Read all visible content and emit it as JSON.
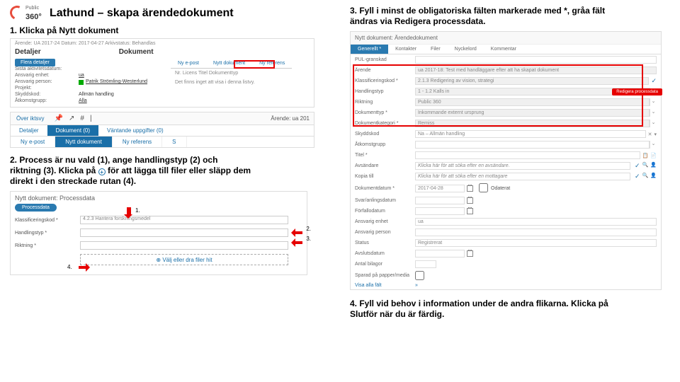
{
  "logo": {
    "brand": "Public",
    "num": "360°"
  },
  "title": "Lathund – skapa ärendedokument",
  "step1": "1. Klicka på Nytt dokument",
  "shot1": {
    "top": "Ärende: UA 2017-24   Datum: 2017-04-27   Arkivstatus: Behandlas",
    "detaljer": "Detaljer",
    "dokument": "Dokument",
    "flera": "Flera detaljer",
    "rows": [
      {
        "l": "Sista aktivitetsdatum:",
        "v": ""
      },
      {
        "l": "Ansvarig enhet:",
        "v": "ua",
        "link": true
      },
      {
        "l": "Ansvarig person:",
        "v": "Patrik Strömling-Westerlund",
        "link": true,
        "green": true
      },
      {
        "l": "Projekt:",
        "v": ""
      },
      {
        "l": "Skyddskod:",
        "v": "Allmän handling"
      },
      {
        "l": "Åtkomstgrupp:",
        "v": "Alla",
        "link": true
      }
    ],
    "rtabs": [
      "Ny e-post",
      "Nytt dokument",
      "Ny referens"
    ],
    "rcols": "Nr.    Licens    Titel    Dokumenttyp",
    "rempty": "Det finns inget att visa i denna listvy."
  },
  "shot2": {
    "ov": "Över iktsvy",
    "ar": "Ärende: ua 201",
    "tabs": [
      "Detaljer",
      "Dokument (0)",
      "Väntande uppgifter (0)"
    ],
    "sub": [
      "Ny e-post",
      "Nytt dokument",
      "Ny referens",
      "S"
    ]
  },
  "step2a": "2. Process är nu vald (1), ange handlingstyp (2) och",
  "step2b": "riktning (3). Klicka på",
  "step2c": "för att lägga till filer eller släpp dem",
  "step2d": "direkt i den streckade rutan (4).",
  "shot3": {
    "ttl": "Nytt dokument: Processdata",
    "pill": "Processdata",
    "rows": [
      {
        "l": "Klassificeringskod *",
        "v": "4.2.3 Hantera forskningsmedel"
      },
      {
        "l": "Handlingstyp *",
        "v": ""
      },
      {
        "l": "Riktning *",
        "v": ""
      }
    ],
    "upload": "⊕ Välj eller dra filer hit",
    "n1": "1.",
    "n2": "2.",
    "n3": "3.",
    "n4": "4."
  },
  "step3a": "3. Fyll i minst de obligatoriska fälten markerade med *, gråa fält",
  "step3b": "ändras via Redigera processdata.",
  "shot4": {
    "top": "Nytt dokument: Ärendedokument",
    "tabs": [
      "Generellt *",
      "Kontakter",
      "Filer",
      "Nyckelord",
      "Kommentar"
    ],
    "f": [
      {
        "l": "PUL-granskad",
        "v": ""
      },
      {
        "l": "Ärende",
        "v": "ua 2017-18: Test med handläggare efter att ha skapat dokument"
      },
      {
        "l": "Klassificeringskod *",
        "v": "2.1.3 Redigering av vision, strategi"
      },
      {
        "l": "Handlingstyp",
        "v": "1 - 1.2 Kalls in"
      },
      {
        "l": "Riktning",
        "v": "Public 360"
      },
      {
        "l": "Dokumenttyp *",
        "v": "Inkommande externt ursprung"
      },
      {
        "l": "Dokumentkategori *",
        "v": "Remiss"
      },
      {
        "l": "Skyddskod",
        "v": "Na – Allmän handling"
      },
      {
        "l": "Åtkomstgrupp",
        "v": ""
      },
      {
        "l": "Titel *",
        "v": ""
      },
      {
        "l": "Avsändare",
        "v": "Klicka här för att söka efter en avsändare."
      },
      {
        "l": "Kopia till",
        "v": "Klicka här för att söka efter en mottagare"
      },
      {
        "l": "Dokumentdatum *",
        "v": "2017-04-28"
      },
      {
        "l": "Svar/anlingsdatum",
        "v": ""
      },
      {
        "l": "Förfallodatum",
        "v": ""
      },
      {
        "l": "Ansvarig enhet",
        "v": "ua"
      },
      {
        "l": "Ansvarig person",
        "v": ""
      },
      {
        "l": "Status",
        "v": "Registrerat"
      },
      {
        "l": "Avslutsdatum",
        "v": ""
      },
      {
        "l": "Antal bilagor",
        "v": ""
      },
      {
        "l": "Sparad på papper/media",
        "v": ""
      },
      {
        "l": "Visa alla fält",
        "v": ""
      }
    ],
    "redbtn": "Redigera processdata",
    "odat": "Odaterat"
  },
  "step4a": "4. Fyll vid behov i information under de andra flikarna. Klicka på",
  "step4b": "Slutför när du är färdig."
}
